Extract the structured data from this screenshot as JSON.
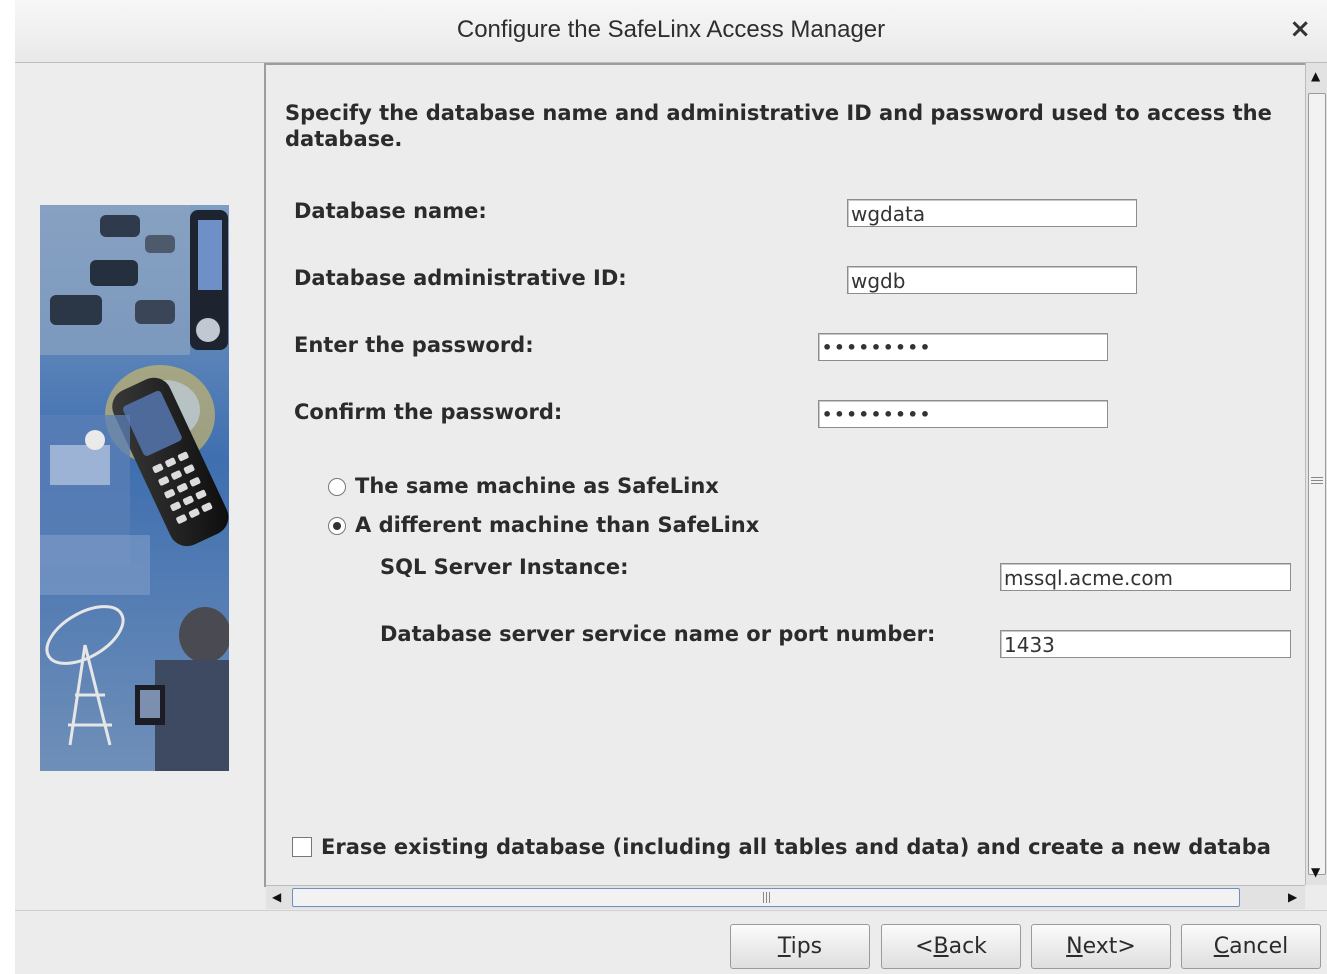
{
  "window": {
    "title": "Configure the SafeLinx Access Manager",
    "close_glyph": "×"
  },
  "content": {
    "intro_line1": "Specify the database name and administrative ID and password used to access the",
    "intro_line2": "database.",
    "db_name_label": "Database name:",
    "db_name_value": "wgdata",
    "admin_id_label": "Database administrative ID:",
    "admin_id_value": "wgdb",
    "password_label": "Enter the password:",
    "password_value": "•••••••••",
    "confirm_label": "Confirm the password:",
    "confirm_value": "•••••••••",
    "radio_same_label": "The same machine as SafeLinx",
    "radio_same_selected": false,
    "radio_diff_label": "A different machine than SafeLinx",
    "radio_diff_selected": true,
    "sql_instance_label": "SQL Server Instance:",
    "sql_instance_value": "mssql.acme.com",
    "port_label": "Database server service name or port number:",
    "port_value": "1433",
    "erase_label": "Erase existing database (including all tables and data) and create a new databa",
    "erase_checked": false
  },
  "buttons": {
    "tips": "Tips",
    "back": "<Back",
    "next": "Next>",
    "cancel": "Cancel"
  },
  "icons": {
    "side_image": "mobile-network-collage-image",
    "scroll_up": "arrow-up-icon",
    "scroll_down": "arrow-down-icon",
    "scroll_left": "arrow-left-icon",
    "scroll_right": "arrow-right-icon"
  }
}
